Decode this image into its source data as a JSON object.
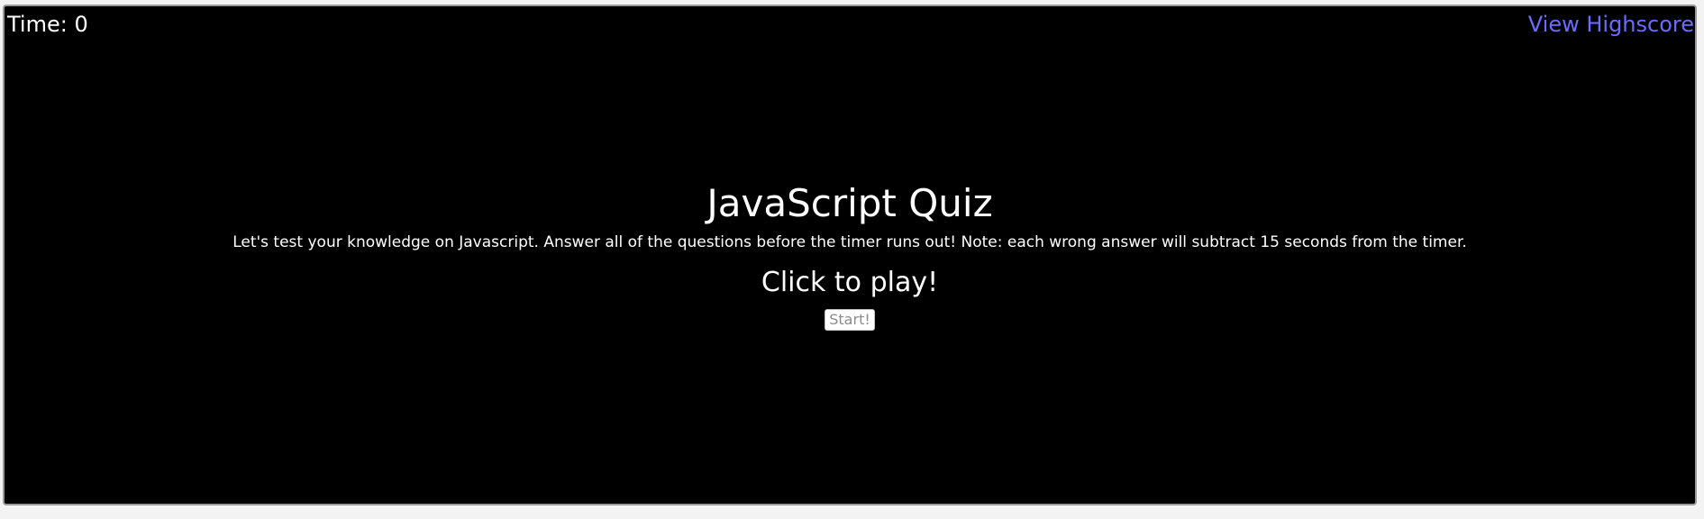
{
  "header": {
    "timer_text": "Time: 0",
    "highscore_link": "View Highscore"
  },
  "intro": {
    "title": "JavaScript Quiz",
    "description": "Let's test your knowledge on Javascript. Answer all of the questions before the timer runs out! Note: each wrong answer will subtract 15 seconds from the timer.",
    "play_prompt": "Click to play!",
    "start_label": "Start!"
  },
  "colors": {
    "panel_background": "#000000",
    "text": "#ffffff",
    "link": "#6b6bff",
    "page_background": "#f3f3f3"
  }
}
